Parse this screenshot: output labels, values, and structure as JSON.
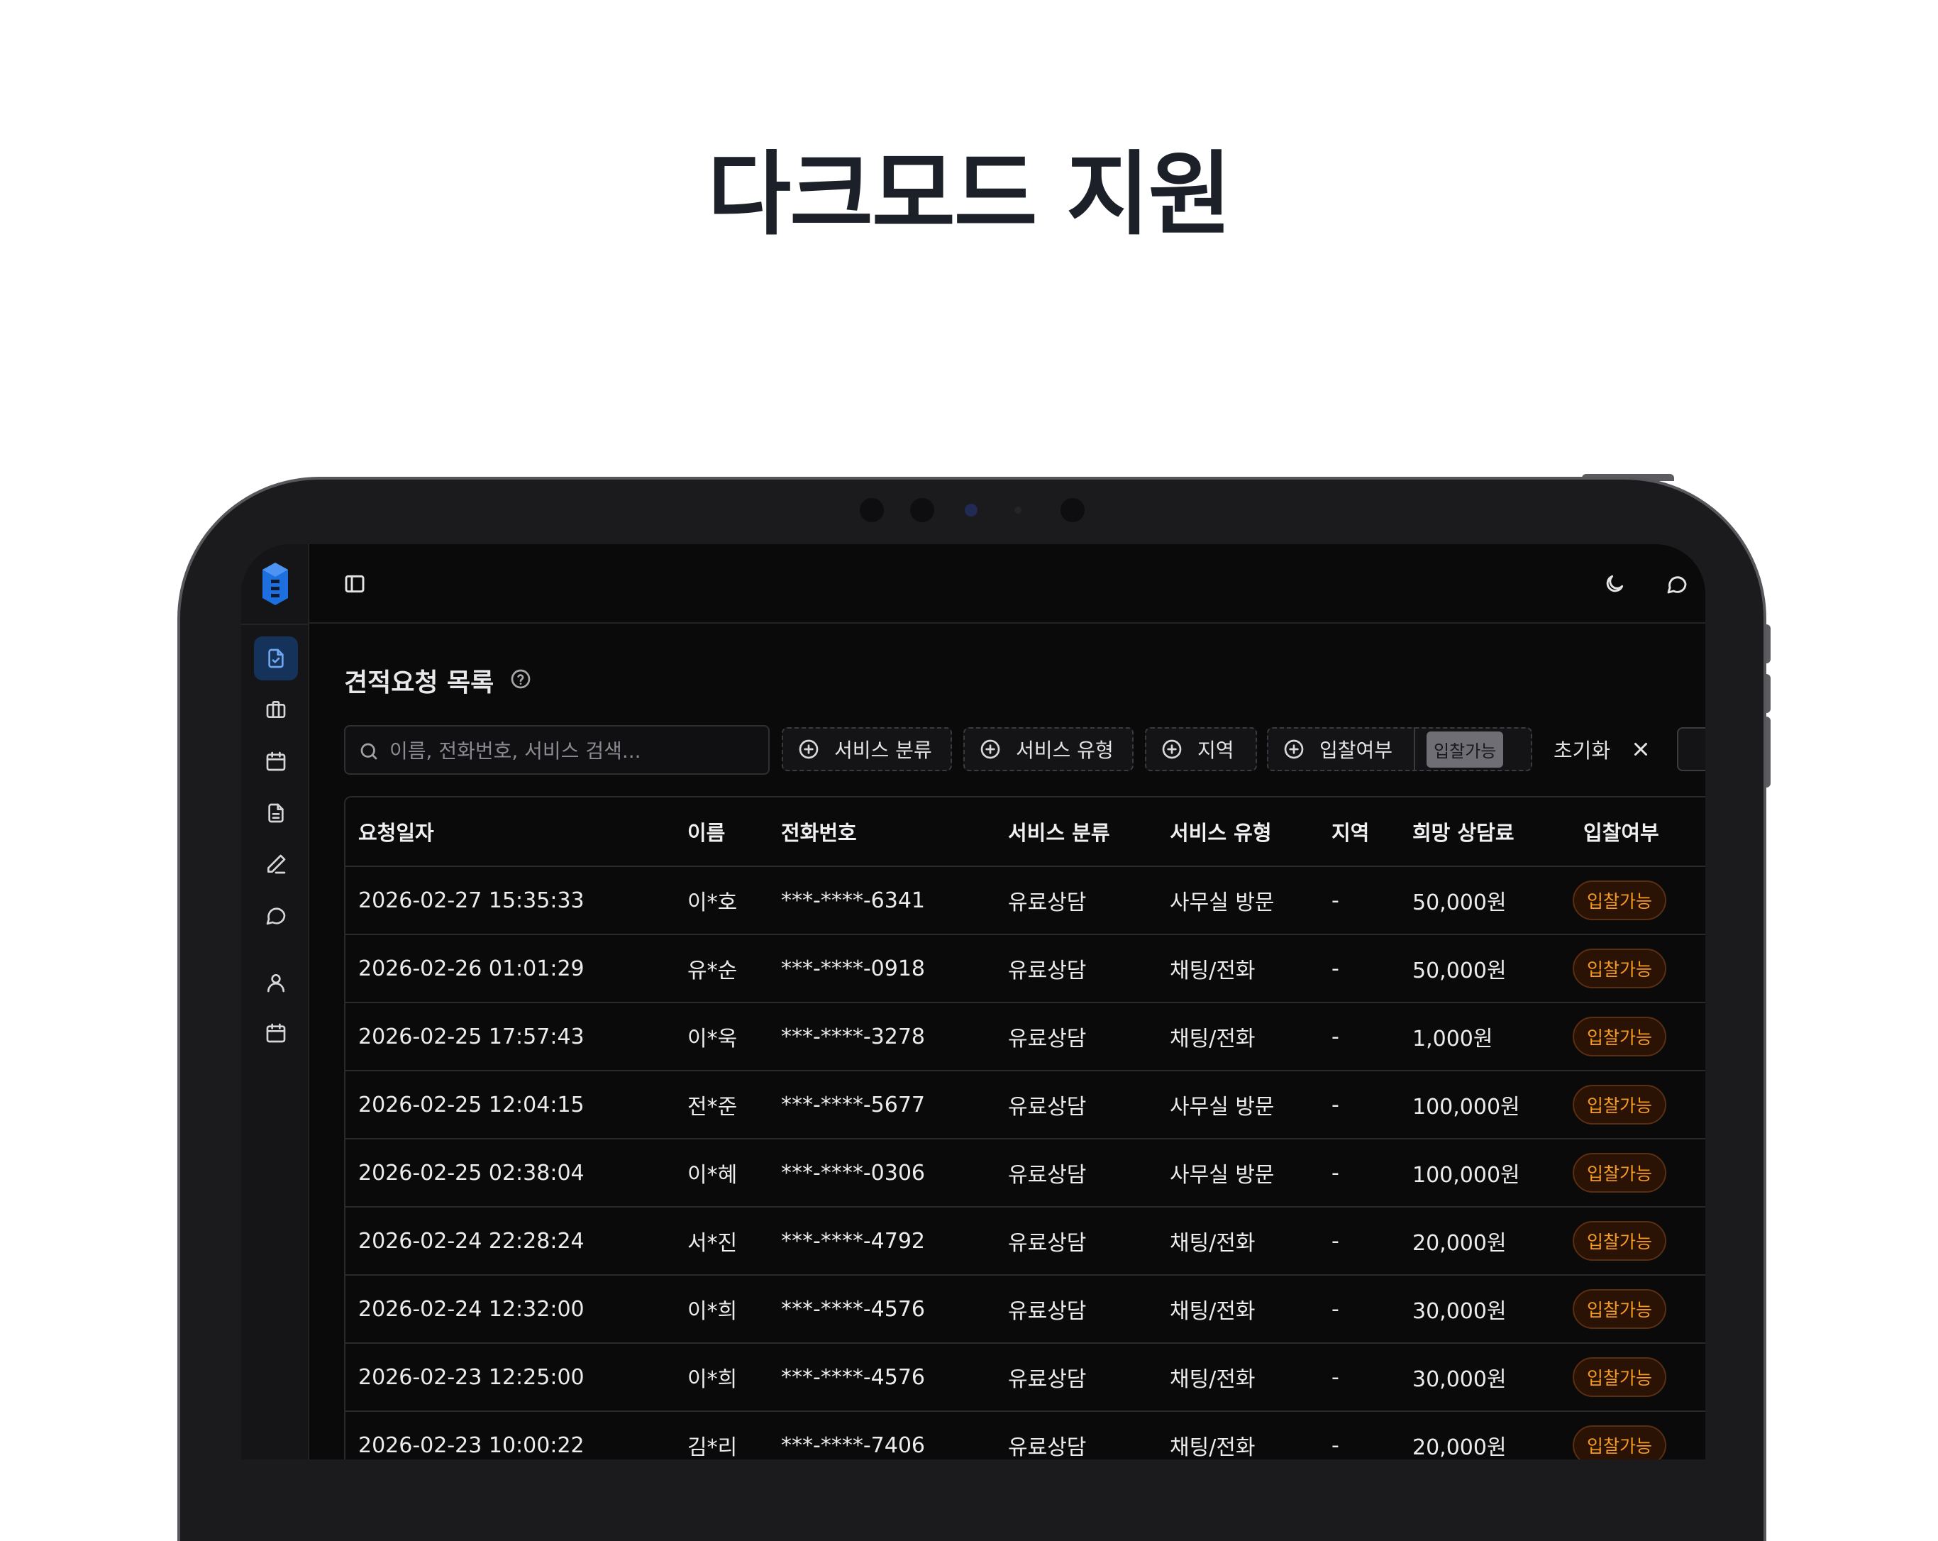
{
  "headline": "다크모드 지원",
  "page_title": "견적요청 목록",
  "search_placeholder": "이름, 전화번호, 서비스 검색...",
  "filters": [
    {
      "label": "서비스 분류"
    },
    {
      "label": "서비스 유형"
    },
    {
      "label": "지역"
    },
    {
      "label": "입찰여부",
      "selected": "입찰가능"
    }
  ],
  "reset_label": "초기화",
  "columns": [
    "요청일자",
    "이름",
    "전화번호",
    "서비스 분류",
    "서비스 유형",
    "지역",
    "희망 상담료",
    "입찰여부"
  ],
  "rows": [
    [
      "2026-02-27 15:35:33",
      "이*호",
      "***-****-6341",
      "유료상담",
      "사무실 방문",
      "-",
      "50,000원",
      "입찰가능"
    ],
    [
      "2026-02-26 01:01:29",
      "유*순",
      "***-****-0918",
      "유료상담",
      "채팅/전화",
      "-",
      "50,000원",
      "입찰가능"
    ],
    [
      "2026-02-25 17:57:43",
      "이*욱",
      "***-****-3278",
      "유료상담",
      "채팅/전화",
      "-",
      "1,000원",
      "입찰가능"
    ],
    [
      "2026-02-25 12:04:15",
      "전*준",
      "***-****-5677",
      "유료상담",
      "사무실 방문",
      "-",
      "100,000원",
      "입찰가능"
    ],
    [
      "2026-02-25 02:38:04",
      "이*혜",
      "***-****-0306",
      "유료상담",
      "사무실 방문",
      "-",
      "100,000원",
      "입찰가능"
    ],
    [
      "2026-02-24 22:28:24",
      "서*진",
      "***-****-4792",
      "유료상담",
      "채팅/전화",
      "-",
      "20,000원",
      "입찰가능"
    ],
    [
      "2026-02-24 12:32:00",
      "이*희",
      "***-****-4576",
      "유료상담",
      "채팅/전화",
      "-",
      "30,000원",
      "입찰가능"
    ],
    [
      "2026-02-23 12:25:00",
      "이*희",
      "***-****-4576",
      "유료상담",
      "채팅/전화",
      "-",
      "30,000원",
      "입찰가능"
    ],
    [
      "2026-02-23 10:00:22",
      "김*리",
      "***-****-7406",
      "유료상담",
      "채팅/전화",
      "-",
      "20,000원",
      "입찰가능"
    ]
  ],
  "colors": {
    "accent": "#1d6fe0",
    "active_nav_bg": "#15325a",
    "badge_text": "#f59a23",
    "screen_bg": "#0a0a0a"
  },
  "icons": {
    "sidebar": [
      "file-check-icon",
      "briefcase-icon",
      "calendar-icon",
      "document-icon",
      "pen-icon",
      "chat-icon",
      "user-icon",
      "calendar-icon"
    ],
    "topbar": [
      "sidebar-toggle-icon",
      "moon-icon",
      "chat-icon"
    ]
  }
}
